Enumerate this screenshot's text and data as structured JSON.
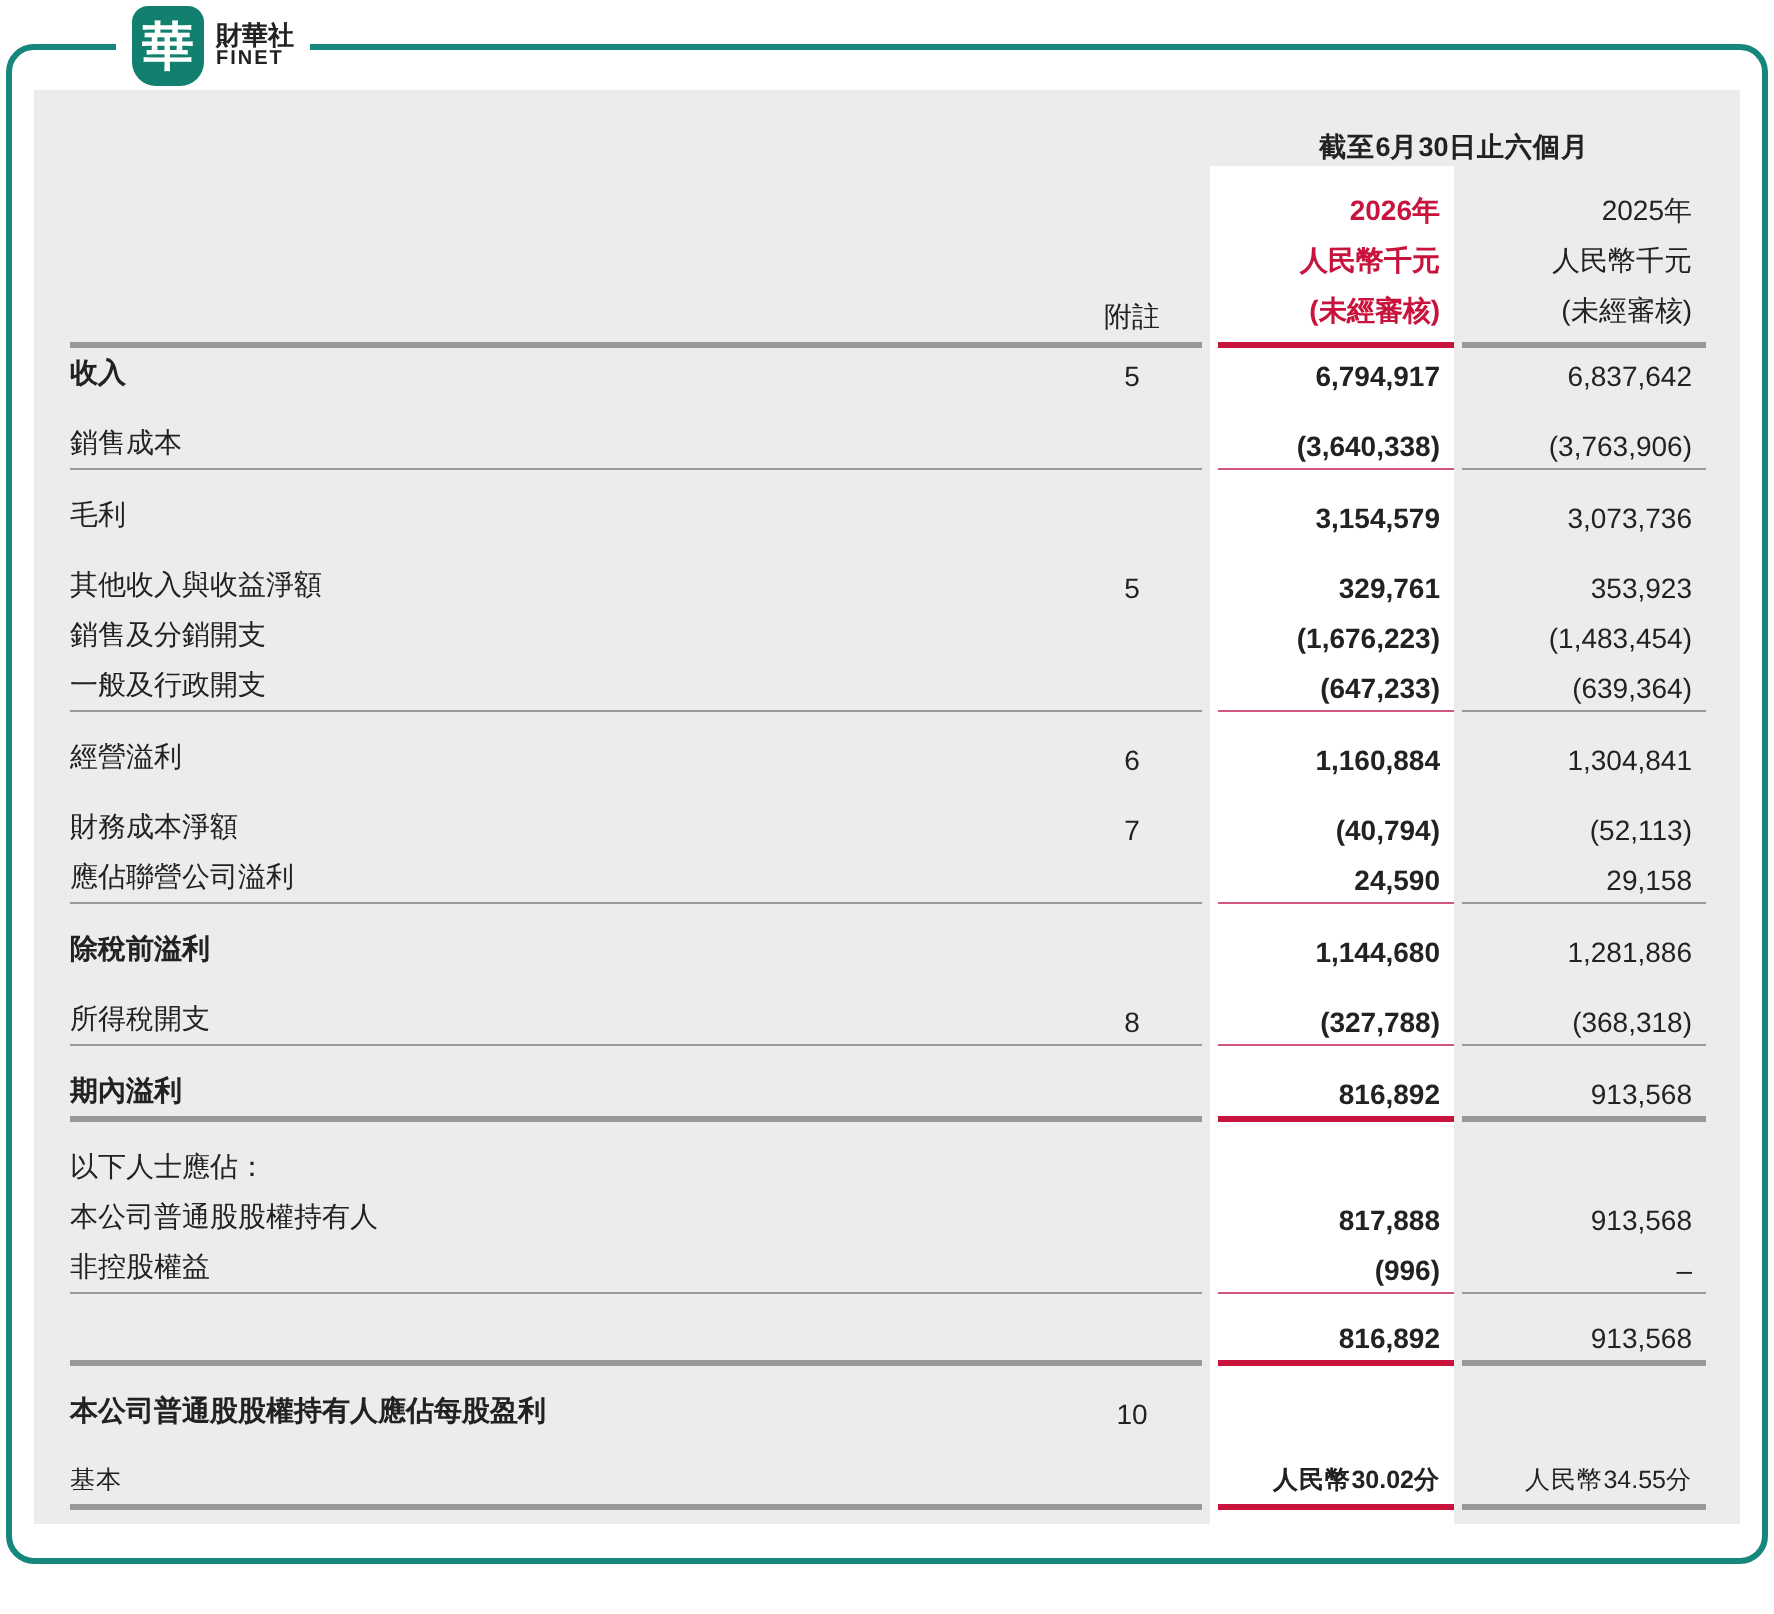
{
  "logo": {
    "mark": "華",
    "name": "財華社",
    "latin": "FINET"
  },
  "table": {
    "period": "截至6月30日止六個月",
    "note_heading": "附註",
    "current_heading": [
      "2026年",
      "人民幣千元",
      "(未經審核)"
    ],
    "prior_heading": [
      "2025年",
      "人民幣千元",
      "(未經審核)"
    ],
    "rows": [
      {
        "label": "收入",
        "bold": true,
        "spaced": false,
        "note": "5",
        "current": "6,794,917",
        "prior": "6,837,642",
        "rule_thin": false,
        "rule_thick": false
      },
      {
        "label": "銷售成本",
        "bold": false,
        "spaced": true,
        "current": "(3,640,338)",
        "prior": "(3,763,906)",
        "rule_thin": true,
        "rule_thick": false
      },
      {
        "label": "毛利",
        "bold": false,
        "spaced": true,
        "current": "3,154,579",
        "prior": "3,073,736",
        "rule_thin": false,
        "rule_thick": false
      },
      {
        "label": "其他收入與收益淨額",
        "bold": false,
        "spaced": true,
        "note": "5",
        "current": "329,761",
        "prior": "353,923",
        "rule_thin": false,
        "rule_thick": false
      },
      {
        "label": "銷售及分銷開支",
        "bold": false,
        "spaced": false,
        "current": "(1,676,223)",
        "prior": "(1,483,454)",
        "rule_thin": false,
        "rule_thick": false
      },
      {
        "label": "一般及行政開支",
        "bold": false,
        "spaced": false,
        "current": "(647,233)",
        "prior": "(639,364)",
        "rule_thin": true,
        "rule_thick": false
      },
      {
        "label": "經營溢利",
        "bold": false,
        "spaced": true,
        "note": "6",
        "current": "1,160,884",
        "prior": "1,304,841",
        "rule_thin": false,
        "rule_thick": false
      },
      {
        "label": "財務成本淨額",
        "bold": false,
        "spaced": true,
        "note": "7",
        "current": "(40,794)",
        "prior": "(52,113)",
        "rule_thin": false,
        "rule_thick": false
      },
      {
        "label": "應佔聯營公司溢利",
        "bold": false,
        "spaced": false,
        "current": "24,590",
        "prior": "29,158",
        "rule_thin": true,
        "rule_thick": false
      },
      {
        "label": "除稅前溢利",
        "bold": true,
        "spaced": true,
        "current": "1,144,680",
        "prior": "1,281,886",
        "rule_thin": false,
        "rule_thick": false
      },
      {
        "label": "所得稅開支",
        "bold": false,
        "spaced": true,
        "note": "8",
        "current": "(327,788)",
        "prior": "(368,318)",
        "rule_thin": true,
        "rule_thick": false
      },
      {
        "label": "期內溢利",
        "bold": true,
        "spaced": true,
        "current": "816,892",
        "prior": "913,568",
        "rule_thin": false,
        "rule_thick": true
      },
      {
        "label": "以下人士應佔：",
        "bold": false,
        "spaced": true,
        "rule_thin": false,
        "rule_thick": false
      },
      {
        "label": "本公司普通股股權持有人",
        "bold": false,
        "spaced": false,
        "current": "817,888",
        "prior": "913,568",
        "rule_thin": false,
        "rule_thick": false
      },
      {
        "label": "非控股權益",
        "bold": false,
        "spaced": false,
        "current": "(996)",
        "prior": "–",
        "rule_thin": true,
        "rule_thick": false
      },
      {
        "spaced": true,
        "current": "816,892",
        "prior": "913,568",
        "rule_thin": false,
        "rule_thick": true
      },
      {
        "label": "本公司普通股股權持有人應佔每股盈利",
        "bold": true,
        "spaced": true,
        "note": "10",
        "rule_thin": false,
        "rule_thick": false
      },
      {
        "label": "基本",
        "bold": false,
        "spaced": true,
        "small": true,
        "current": "人民幣30.02分",
        "prior": "人民幣34.55分",
        "rule_thin": false,
        "rule_thick": true
      }
    ]
  }
}
